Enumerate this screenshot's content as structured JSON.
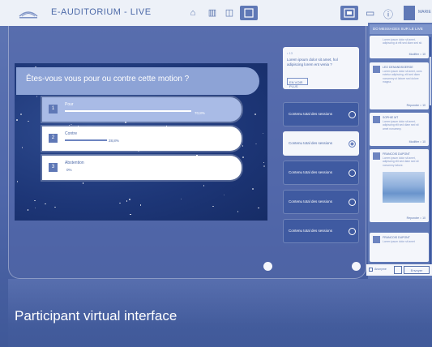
{
  "header": {
    "title": "E-AUDITORIUM - LIVE",
    "user": "MARIE"
  },
  "slide": {
    "question": "Êtes-vous vous pour ou contre cette motion ?",
    "options": [
      {
        "num": "1",
        "label": "Pour",
        "pct": "70,8%"
      },
      {
        "num": "2",
        "label": "Contre",
        "pct": "28,8%"
      },
      {
        "num": "3",
        "label": "Abstention",
        "pct": "0%"
      }
    ]
  },
  "info_card": {
    "small": "• 13",
    "text": "Lorem ipsum dolor sit amet, hol adipiscing lorem ent venia ?",
    "button": "EN VOIR PLUS"
  },
  "topics": [
    "Contenu total des sessions",
    "Contenu total des sessions",
    "Contenu total des sessions",
    "Contenu total des sessions",
    "Contenu total des sessions"
  ],
  "chat": {
    "header": "DO MESSAGES SUR LE LIVE",
    "messages": [
      {
        "name": "",
        "text": "Lorem ipsum dolor sit amet, adipiscing ut elit sed diam sed sit.",
        "foot": "Modifier  ○ 10"
      },
      {
        "name": "LEO DENANDSGERGE",
        "text": "Lorem ipsum dolor sit amet, cons ectetur adipiscing, elit sed diam nonummy ut labore sed dolore magna.",
        "foot": "Repondre  ○ 10"
      },
      {
        "name": "SOPHIE MT",
        "text": "Lorem ipsum dolor sit amet, adipiscing elit sed diam sed sit amet nonummy.",
        "foot": "Modifier  ○ 10"
      },
      {
        "name": "FRANCOIS DUPONT",
        "text": "Lorem ipsum dolor sit amet, adipiscing elit sed diam sed sit nonummy labore.",
        "foot": "Repondre  ○ 10"
      },
      {
        "name": "FRANCOIS DUPONT",
        "text": "Lorem ipsum dolor sit amet",
        "foot": ""
      }
    ],
    "checkbox_label": "Anonyme",
    "send_label": "Envoyer"
  },
  "caption": "Participant virtual interface"
}
